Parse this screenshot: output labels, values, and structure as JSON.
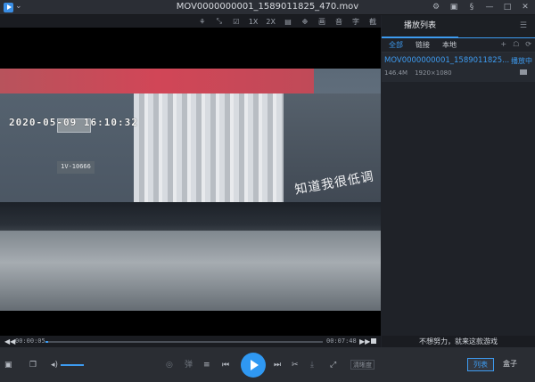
{
  "window": {
    "title": "MOV0000000001_1589011825_470.mov",
    "menu_chevron": "⌄",
    "controls": [
      "⚙",
      "▣",
      "§",
      "—",
      "□",
      "✕"
    ]
  },
  "toolbar": {
    "items": [
      "⚘",
      "⤡",
      "☑",
      "1X",
      "2X",
      "▤",
      "❉",
      "画",
      "音",
      "字",
      "截"
    ]
  },
  "video": {
    "timestamp": "2020-05-09 16:10:32",
    "plate_sign": "1V-10666",
    "graffiti": "知道我很低调"
  },
  "progress": {
    "current": "00:00:05",
    "total": "00:07:48",
    "percent": 0.011,
    "rewind_icon": "◀◀",
    "forward_icon": "▶▶"
  },
  "playlist": {
    "header": "播放列表",
    "header_icon": "☰",
    "tabs": [
      "全部",
      "链接",
      "本地"
    ],
    "tab_icons": [
      "+",
      "☖",
      "⟳"
    ],
    "items": [
      {
        "name": "MOV0000000001_1589011825...",
        "state": "播放中",
        "size": "146.4M",
        "resolution": "1920×1080"
      }
    ]
  },
  "ad": "不想努力，就来这款游戏",
  "controls": {
    "quality": "清晰度",
    "list_button": "列表",
    "box_button": "盒子",
    "danmaku": "弹",
    "icons": {
      "box": "▣",
      "folder": "❐",
      "volume": "◂)",
      "eye": "◎",
      "equalizer": "≡",
      "prev": "⏮",
      "next": "⏭",
      "cut": "✂",
      "download": "⤓",
      "fullscreen": "⤢"
    }
  },
  "colors": {
    "accent": "#3d9bf0",
    "background": "#1f2228"
  }
}
